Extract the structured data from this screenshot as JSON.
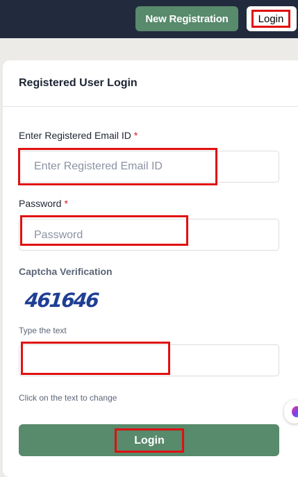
{
  "header": {
    "new_registration_label": "New Registration",
    "login_label": "Login"
  },
  "form": {
    "title": "Registered User Login",
    "email": {
      "label": "Enter Registered Email ID",
      "required_mark": "*",
      "placeholder": "Enter Registered Email ID",
      "value": ""
    },
    "password": {
      "label": "Password",
      "required_mark": "*",
      "placeholder": "Password",
      "value": ""
    },
    "captcha": {
      "label": "Captcha Verification",
      "code": "461646",
      "type_hint": "Type the text",
      "value": "",
      "change_hint": "Click on the text to change"
    },
    "submit_label": "Login"
  },
  "colors": {
    "topbar": "#222b3d",
    "button_green": "#588a6c",
    "highlight_red": "#e01010",
    "required_red": "#d9161b",
    "captcha_blue": "#1f3f95"
  },
  "icons": {
    "floating_widget": "chat-assistant-icon"
  }
}
